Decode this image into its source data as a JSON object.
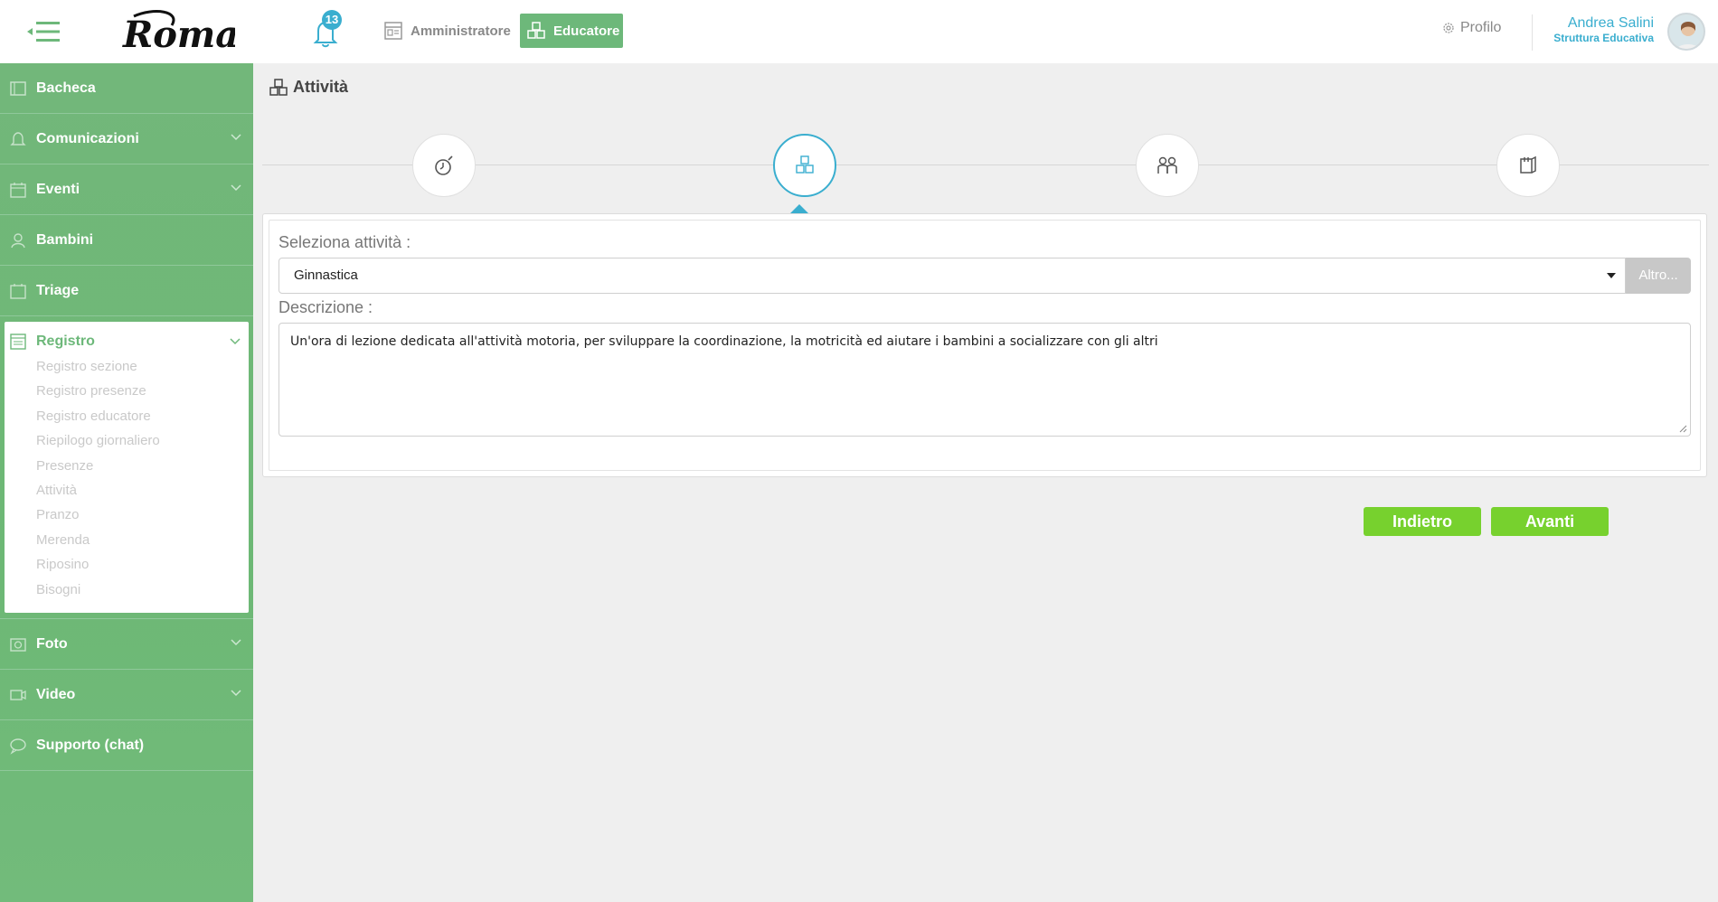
{
  "header": {
    "logo_text": "Roma",
    "notifications_count": "13",
    "roles": [
      {
        "label": "Amministratore",
        "active": false
      },
      {
        "label": "Educatore",
        "active": true
      }
    ],
    "profile_label": "Profilo",
    "user_name": "Andrea Salini",
    "user_role": "Struttura Educativa"
  },
  "sidebar": {
    "items_top": [
      {
        "label": "Bacheca",
        "icon": "board-icon",
        "has_chevron": false
      },
      {
        "label": "Comunicazioni",
        "icon": "bell-icon",
        "has_chevron": true
      },
      {
        "label": "Eventi",
        "icon": "calendar-icon",
        "has_chevron": true
      },
      {
        "label": "Bambini",
        "icon": "children-icon",
        "has_chevron": false
      },
      {
        "label": "Triage",
        "icon": "triage-icon",
        "has_chevron": false
      }
    ],
    "open_section": {
      "label": "Registro",
      "icon": "register-icon",
      "sub_items": [
        "Registro sezione",
        "Registro presenze",
        "Registro educatore",
        "Riepilogo giornaliero",
        "Presenze",
        "Attività",
        "Pranzo",
        "Merenda",
        "Riposino",
        "Bisogni"
      ]
    },
    "items_bottom": [
      {
        "label": "Foto",
        "icon": "photo-icon",
        "has_chevron": true
      },
      {
        "label": "Video",
        "icon": "video-icon",
        "has_chevron": true
      },
      {
        "label": "Supporto (chat)",
        "icon": "chat-icon",
        "has_chevron": false
      }
    ]
  },
  "main": {
    "page_title": "Attività",
    "steps": [
      {
        "icon": "timer-icon",
        "active": false
      },
      {
        "icon": "blocks-icon",
        "active": true
      },
      {
        "icon": "people-icon",
        "active": false
      },
      {
        "icon": "notes-icon",
        "active": false
      }
    ],
    "form": {
      "select_label": "Seleziona attività :",
      "select_value": "Ginnastica",
      "altro_label": "Altro...",
      "description_label": "Descrizione :",
      "description_value": "Un'ora di lezione dedicata all'attività motoria, per sviluppare la coordinazione, la motricità ed aiutare i bambini a socializzare con gli altri"
    },
    "buttons": {
      "back": "Indietro",
      "next": "Avanti"
    }
  },
  "colors": {
    "green": "#6db87a",
    "blue": "#3aaecf",
    "button_green": "#77d12e"
  }
}
